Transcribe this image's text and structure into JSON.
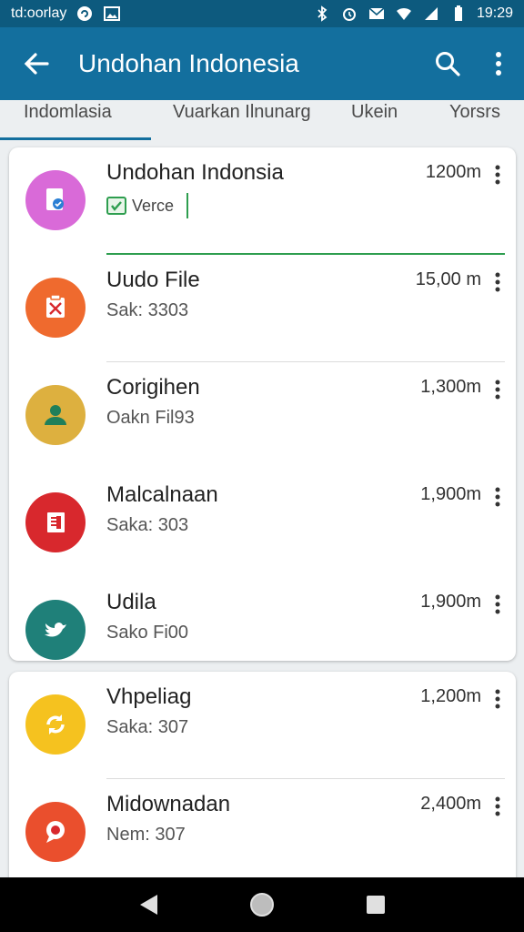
{
  "status_bar": {
    "left_text": "td:oorlay",
    "time": "19:29",
    "icons_left": [
      "sync-circle-icon",
      "image-icon"
    ],
    "icons_right": [
      "bluetooth-icon",
      "alarm-icon",
      "mail-icon",
      "wifi-icon",
      "signal-icon",
      "battery-icon"
    ]
  },
  "app_bar": {
    "title": "Undohan Indonesia",
    "back_icon": "arrow-left-icon",
    "search_icon": "search-icon",
    "menu_icon": "overflow-menu-icon"
  },
  "tabs": [
    {
      "label": "Indomlasia",
      "active": true
    },
    {
      "label": "Vuarkan Ilnunarg",
      "active": false
    },
    {
      "label": "Ukein",
      "active": false
    },
    {
      "label": "Yorsrs",
      "active": false
    }
  ],
  "card1": {
    "items": [
      {
        "name": "Undohan Indonsia",
        "size": "1200m",
        "verify_text": "Verce",
        "avatar_color": "#d96ad8",
        "icon": "document-badge-icon",
        "editing": true
      },
      {
        "name": "Uudo File",
        "size": "15,00 m",
        "sub": "Sak: 3303",
        "avatar_color": "#ef6a2e",
        "icon": "clipboard-x-icon"
      },
      {
        "name": "Corigihen",
        "size": "1,300m",
        "sub": "Oakn Fil93",
        "avatar_color": "#ddb03f",
        "icon": "person-icon"
      },
      {
        "name": "Malcalnaan",
        "size": "1,900m",
        "sub": "Saka: 303",
        "avatar_color": "#d8282d",
        "icon": "document-lines-icon"
      },
      {
        "name": "Udila",
        "size": "1,900m",
        "sub": "Sako Fi00",
        "avatar_color": "#1f8079",
        "icon": "bird-icon"
      }
    ]
  },
  "card2": {
    "items": [
      {
        "name": "Vhpeliag",
        "size": "1,200m",
        "sub": "Saka: 307",
        "avatar_color": "#f5c21f",
        "icon": "refresh-arrows-icon"
      },
      {
        "name": "Midownadan",
        "size": "2,400m",
        "sub": "Nem: 307",
        "avatar_color": "#ea4f2d",
        "icon": "chat-bubble-icon"
      }
    ]
  },
  "nav_bar": {
    "icons": [
      "back-triangle-icon",
      "home-circle-icon",
      "recents-square-icon"
    ]
  }
}
